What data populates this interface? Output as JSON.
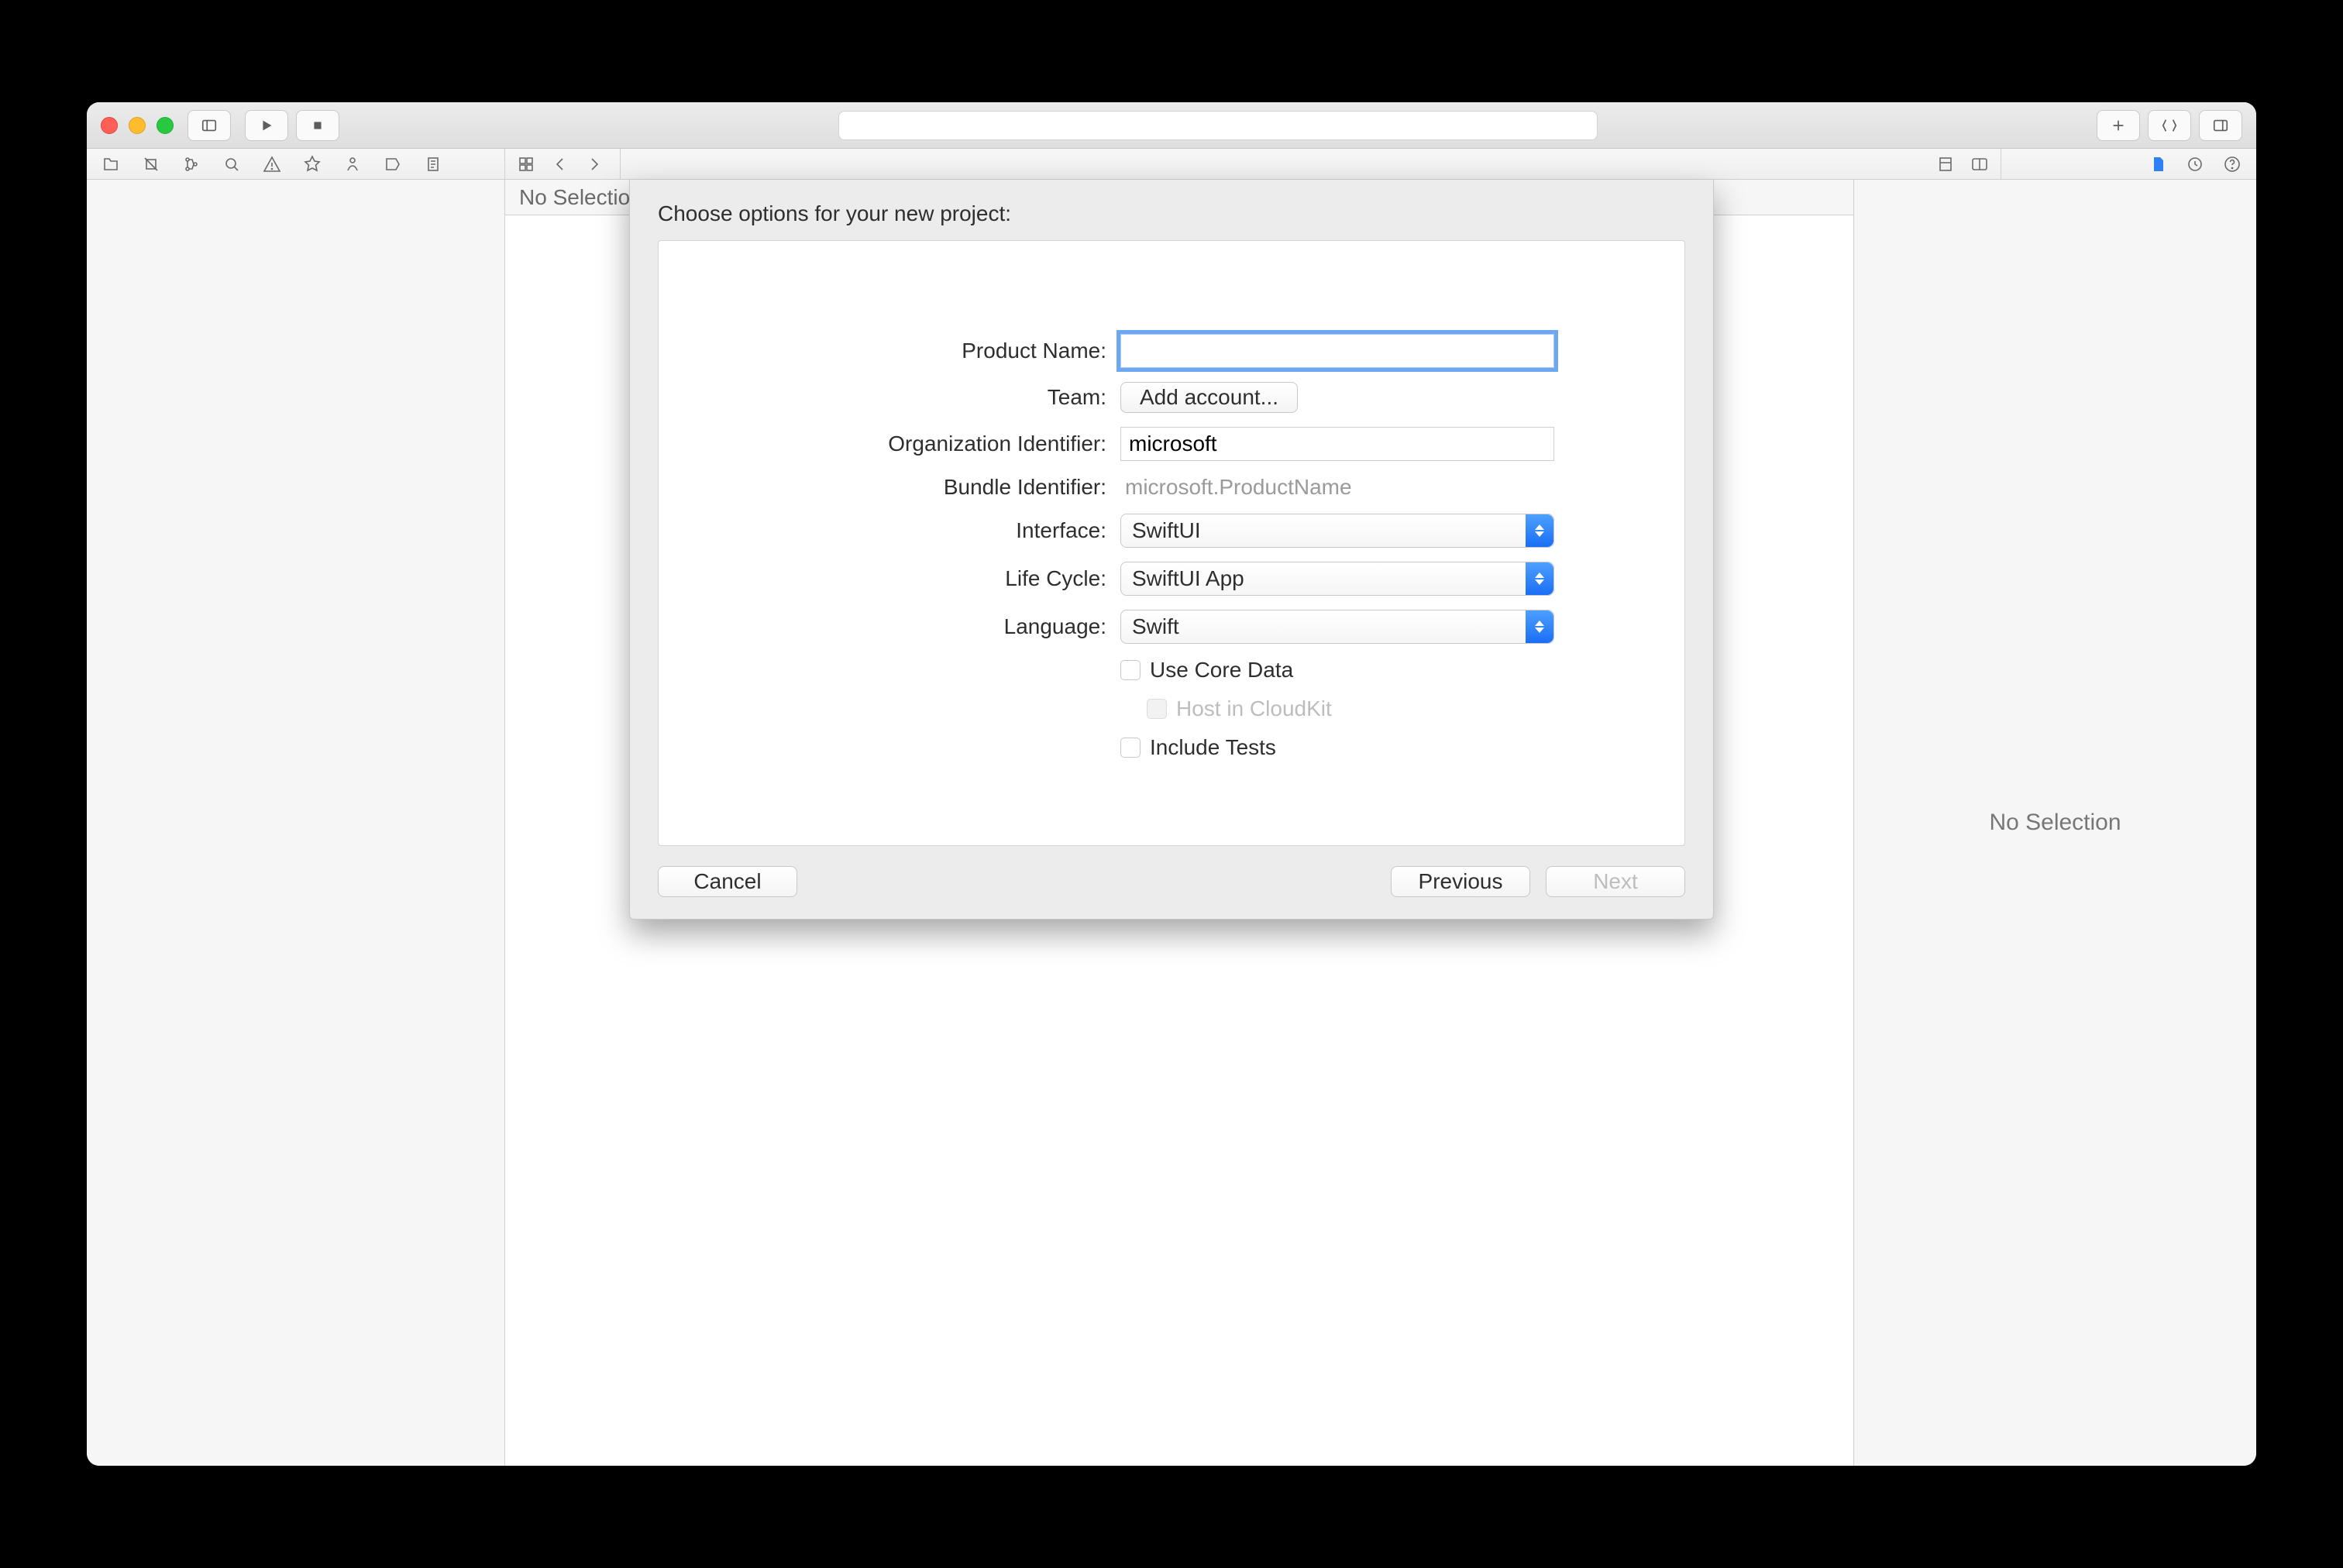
{
  "jumpbar": {
    "text": "No Selection"
  },
  "inspector": {
    "placeholder": "No Selection"
  },
  "sheet": {
    "title": "Choose options for your new project:",
    "form": {
      "product_name": {
        "label": "Product Name:",
        "value": ""
      },
      "team": {
        "label": "Team:",
        "button": "Add account..."
      },
      "org_id": {
        "label": "Organization Identifier:",
        "value": "microsoft"
      },
      "bundle_id": {
        "label": "Bundle Identifier:",
        "value": "microsoft.ProductName"
      },
      "interface": {
        "label": "Interface:",
        "selected": "SwiftUI"
      },
      "lifecycle": {
        "label": "Life Cycle:",
        "selected": "SwiftUI App"
      },
      "language": {
        "label": "Language:",
        "selected": "Swift"
      },
      "use_core_data": {
        "label": "Use Core Data",
        "checked": false
      },
      "host_cloudkit": {
        "label": "Host in CloudKit",
        "checked": false,
        "disabled": true
      },
      "include_tests": {
        "label": "Include Tests",
        "checked": false
      }
    },
    "buttons": {
      "cancel": "Cancel",
      "previous": "Previous",
      "next": "Next"
    }
  }
}
